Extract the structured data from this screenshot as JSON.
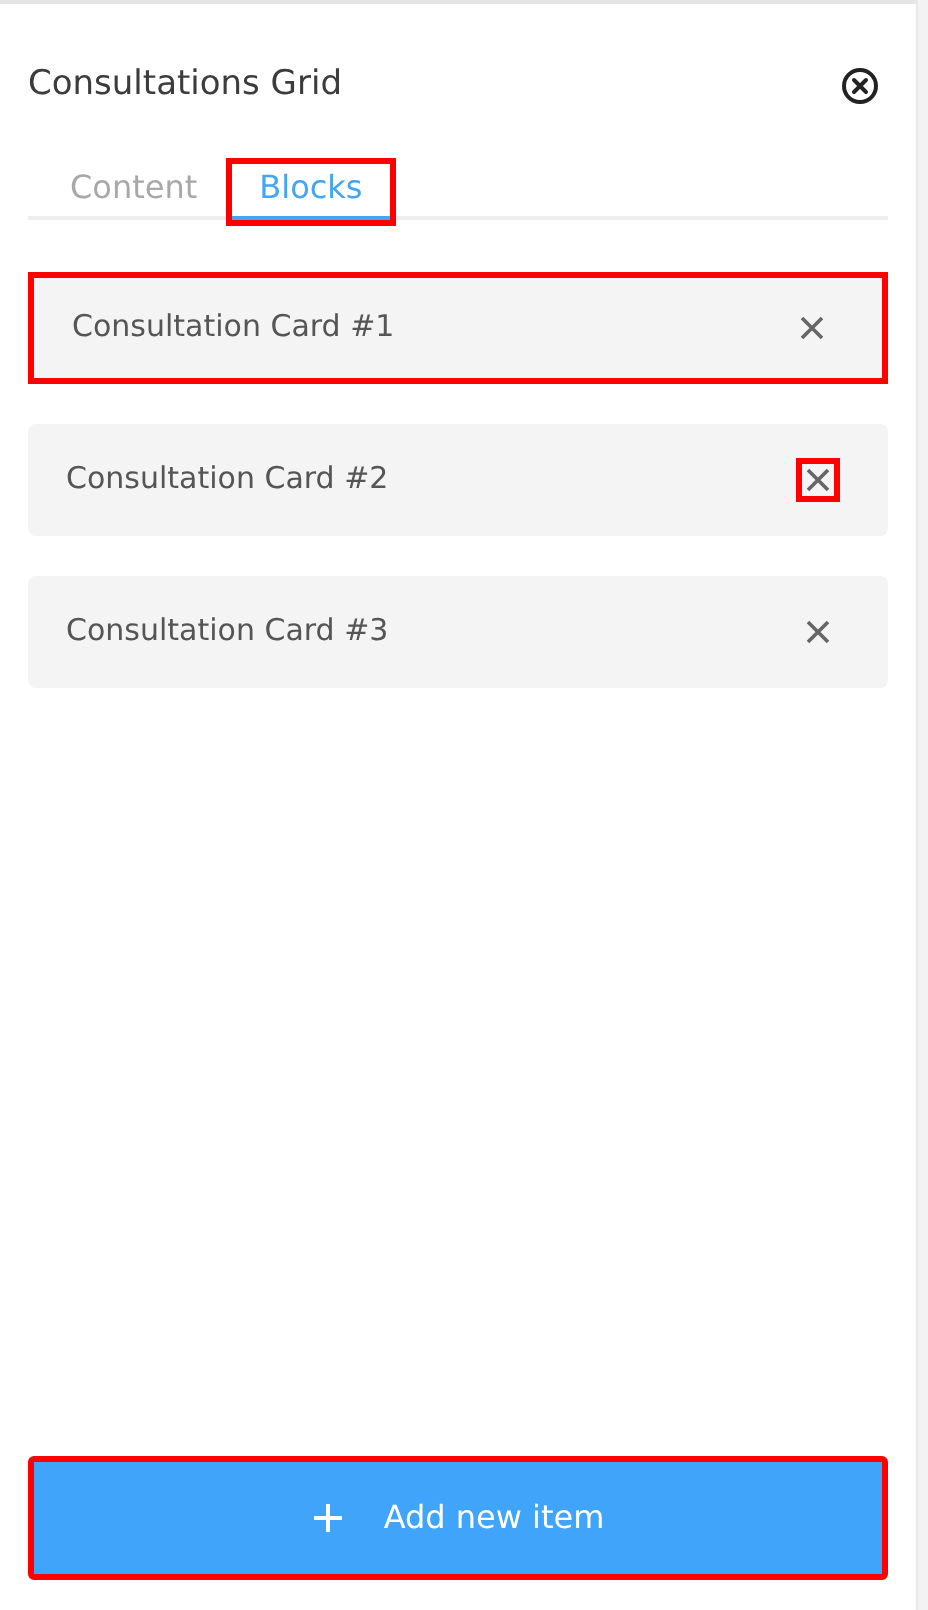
{
  "panel": {
    "title": "Consultations Grid"
  },
  "tabs": [
    {
      "label": "Content",
      "selected": false,
      "highlighted": false
    },
    {
      "label": "Blocks",
      "selected": true,
      "highlighted": true
    }
  ],
  "items": [
    {
      "label": "Consultation Card #1",
      "highlighted": true,
      "remove_highlighted": false
    },
    {
      "label": "Consultation Card #2",
      "highlighted": false,
      "remove_highlighted": true
    },
    {
      "label": "Consultation Card #3",
      "highlighted": false,
      "remove_highlighted": false
    }
  ],
  "add_button": {
    "label": "Add new item",
    "highlighted": true
  }
}
